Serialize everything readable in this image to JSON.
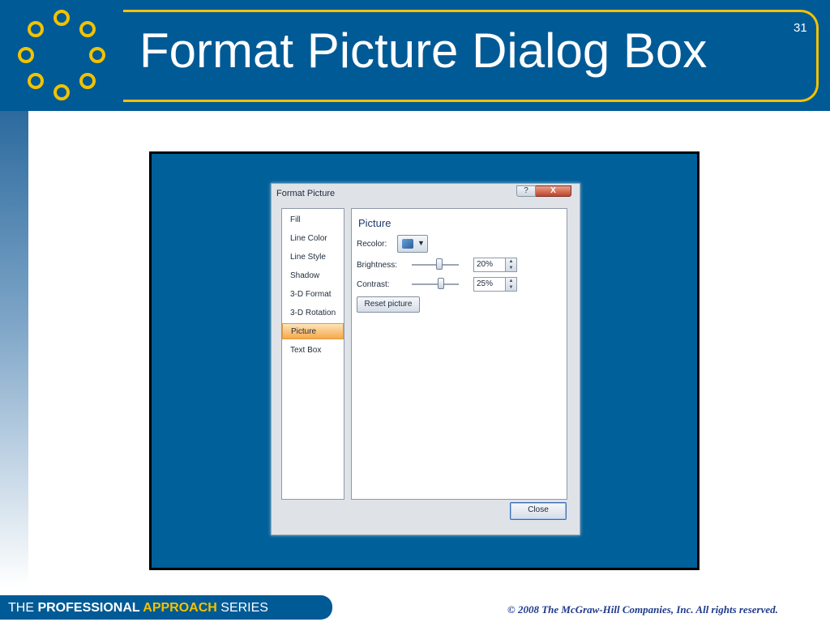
{
  "slide": {
    "title": "Format Picture Dialog Box",
    "number": "31"
  },
  "dialog": {
    "title": "Format Picture",
    "help_label": "?",
    "close_x_label": "X",
    "categories": [
      "Fill",
      "Line Color",
      "Line Style",
      "Shadow",
      "3-D Format",
      "3-D Rotation",
      "Picture",
      "Text Box"
    ],
    "selected_category": "Picture",
    "panel": {
      "heading": "Picture",
      "recolor_label": "Recolor:",
      "brightness_label": "Brightness:",
      "brightness_value": "20%",
      "contrast_label": "Contrast:",
      "contrast_value": "25%",
      "reset_label": "Reset picture"
    },
    "close_label": "Close"
  },
  "footer": {
    "series_the": "THE ",
    "series_professional": "PROFESSIONAL",
    "series_approach": " APPROACH",
    "series_series": " SERIES",
    "copyright": "© 2008 The McGraw-Hill Companies, Inc. All rights reserved."
  },
  "colors": {
    "brand_blue": "#005a96",
    "accent_gold": "#f2c200",
    "selection_orange": "#f6a94c"
  },
  "icons": [
    "gold-circles-logo",
    "help-icon",
    "close-icon",
    "recolor-icon",
    "dropdown-arrow-icon",
    "spin-arrows-icon"
  ]
}
